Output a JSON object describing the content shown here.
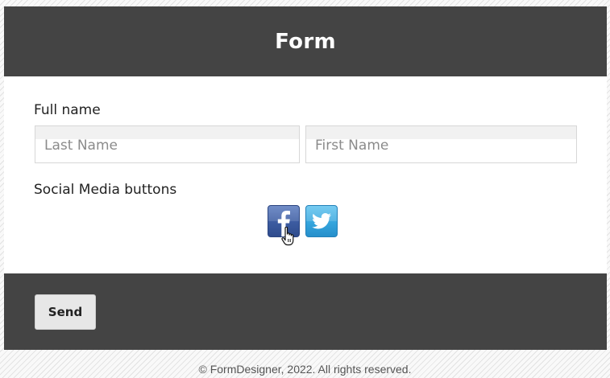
{
  "form": {
    "title": "Form"
  },
  "fields": {
    "full_name_label": "Full name",
    "last_name_placeholder": "Last Name",
    "first_name_placeholder": "First Name",
    "social_label": "Social Media buttons"
  },
  "social_buttons": [
    {
      "name": "facebook",
      "icon": "facebook-icon",
      "color": "#3b5998"
    },
    {
      "name": "twitter",
      "icon": "twitter-icon",
      "color": "#2fa6df"
    }
  ],
  "footer": {
    "send_label": "Send"
  },
  "copyright": "© FormDesigner, 2022. All rights reserved.",
  "colors": {
    "header_bg": "#444444",
    "footer_bg": "#444444",
    "button_bg": "#e7e7e7"
  }
}
